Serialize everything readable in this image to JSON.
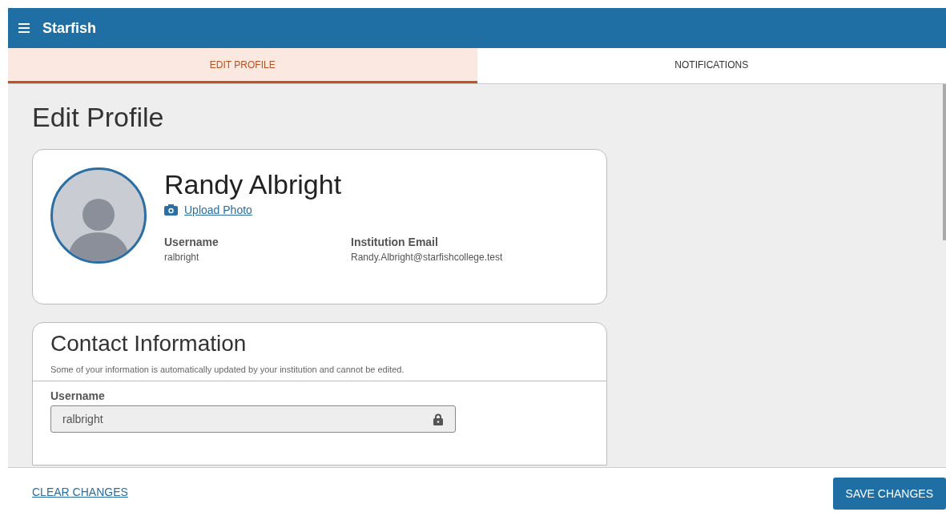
{
  "header": {
    "title": "Starfish"
  },
  "tabs": [
    {
      "label": "EDIT PROFILE",
      "selected": true
    },
    {
      "label": "NOTIFICATIONS",
      "selected": false
    }
  ],
  "page_title": "Edit Profile",
  "profile": {
    "name": "Randy Albright",
    "upload_link": "Upload Photo",
    "details": [
      {
        "label": "Username",
        "value": "ralbright"
      },
      {
        "label": "Institution Email",
        "value": "Randy.Albright@starfishcollege.test"
      }
    ]
  },
  "contact": {
    "title": "Contact Information",
    "note": "Some of your information is automatically updated by your institution and cannot be edited.",
    "fields": [
      {
        "label": "Username",
        "value": "ralbright",
        "disabled": true
      }
    ]
  },
  "footer": {
    "clear": "CLEAR CHANGES",
    "save": "SAVE CHANGES"
  }
}
